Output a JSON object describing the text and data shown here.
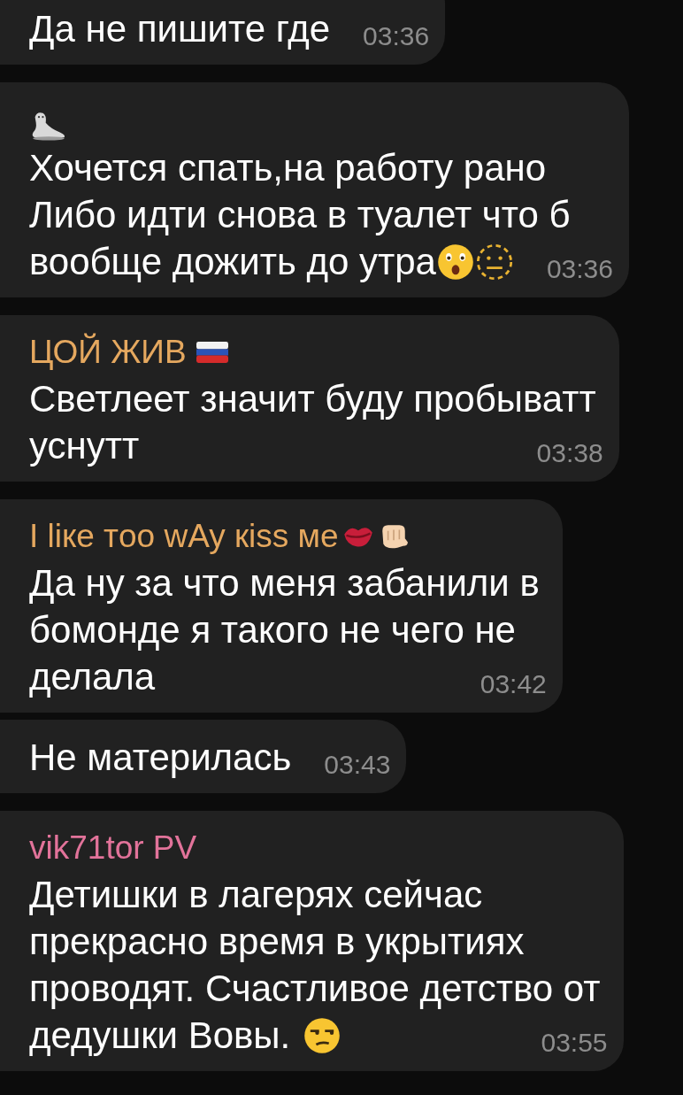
{
  "messages": [
    {
      "lines": [
        "Да не пишите где"
      ],
      "time": "03:36"
    },
    {
      "lines": [
        "Хочется спать,на работу рано",
        "Либо идти снова в туалет что б",
        "вообще дожить до утра"
      ],
      "time": "03:36"
    },
    {
      "sender": {
        "name": "ЦОЙ ЖИВ",
        "color": "#e5a85f"
      },
      "lines": [
        "Светлеет значит буду пробыватт",
        "уснутт"
      ],
      "time": "03:38"
    },
    {
      "sender": {
        "name": "I liкe тoo wAy кiss мe",
        "color": "#e5a85f"
      },
      "lines": [
        "Да ну за что меня забанили в",
        "бомонде я такого не чего не",
        "делала"
      ],
      "time": "03:42"
    },
    {
      "lines": [
        "Не материлась"
      ],
      "time": "03:43"
    },
    {
      "sender": {
        "name": "vik71tor PV",
        "color": "#e2739a"
      },
      "lines": [
        "Детишки в лагерях сейчас",
        "прекрасно время в укрытиях",
        "проводят. Счастливое детство от",
        "дедушки Вовы."
      ],
      "time": "03:55"
    }
  ]
}
